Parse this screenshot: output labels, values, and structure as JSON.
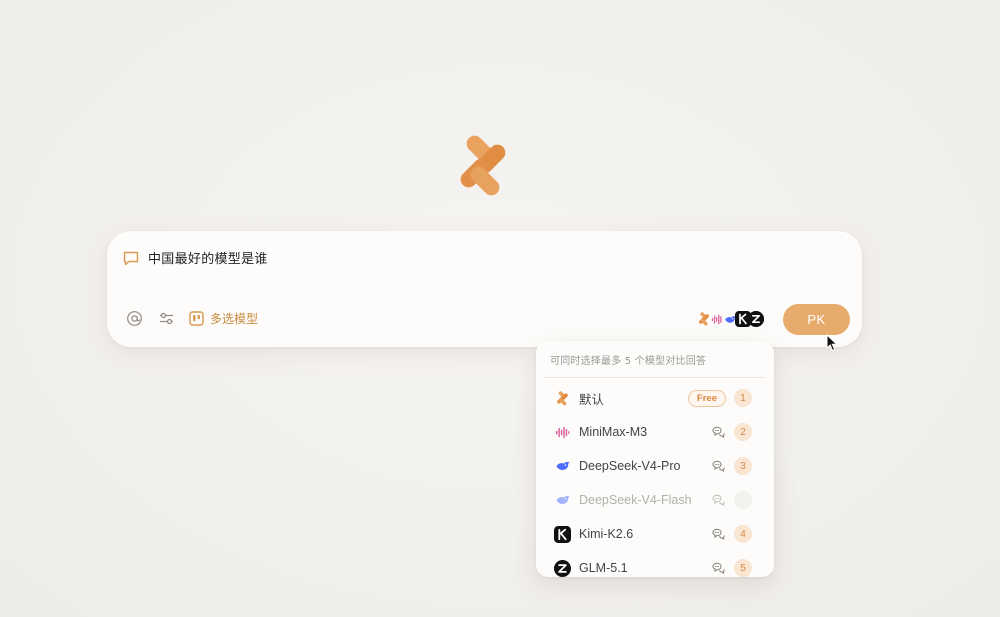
{
  "prompt": {
    "text": "中国最好的模型是谁"
  },
  "toolbar": {
    "mention_icon": "at-icon",
    "settings_icon": "sliders-icon",
    "multi_select_label": "多选模型"
  },
  "pk_button_label": "PK",
  "dropdown": {
    "hint": "可同时选择最多 5 个模型对比回答",
    "items": [
      {
        "name": "默认",
        "icon": "brand-logo-icon",
        "badge": "Free",
        "rank": "1",
        "disabled": false
      },
      {
        "name": "MiniMax-M3",
        "icon": "minimax-icon",
        "rank": "2",
        "disabled": false
      },
      {
        "name": "DeepSeek-V4-Pro",
        "icon": "deepseek-icon",
        "rank": "3",
        "disabled": false
      },
      {
        "name": "DeepSeek-V4-Flash",
        "icon": "deepseek-icon",
        "rank": "",
        "disabled": true
      },
      {
        "name": "Kimi-K2.6",
        "icon": "kimi-icon",
        "rank": "4",
        "disabled": false
      },
      {
        "name": "GLM-5.1",
        "icon": "glm-icon",
        "rank": "5",
        "disabled": false
      }
    ]
  },
  "colors": {
    "accent": "#e7ac6c",
    "accent_text": "#c98a3d",
    "rank_bg": "#f9e5d2"
  }
}
